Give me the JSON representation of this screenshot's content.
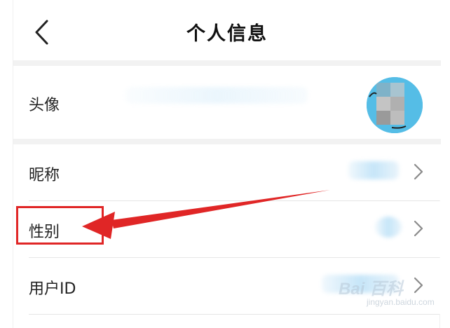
{
  "header": {
    "title": "个人信息",
    "back_icon": "chevron-left-icon"
  },
  "rows": [
    {
      "key": "avatar",
      "label": "头像",
      "value_type": "avatar-image"
    },
    {
      "key": "nickname",
      "label": "昵称",
      "value_type": "obscured-text",
      "trailing_icon": "chevron-right-icon"
    },
    {
      "key": "gender",
      "label": "性别",
      "value_type": "obscured-text",
      "trailing_icon": "chevron-right-icon"
    },
    {
      "key": "user_id",
      "label": "用户ID",
      "value_type": "obscured-text",
      "trailing_icon": "chevron-right-icon"
    }
  ],
  "annotation": {
    "color": "#e02626",
    "target_row": "gender",
    "shapes": [
      "highlight-box",
      "arrow"
    ]
  },
  "watermark": {
    "logo_text": "Bai  百科",
    "sub_text": "jingyan.baidu.com"
  },
  "colors": {
    "background": "#ffffff",
    "section_gap": "#f2f2f2",
    "divider": "#e6e6e6",
    "annotation_red": "#e02626"
  }
}
